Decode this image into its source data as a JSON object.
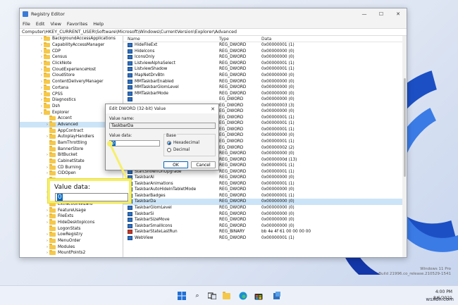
{
  "window": {
    "title": "Registry Editor",
    "minimize": "—",
    "maximize": "☐",
    "close": "✕"
  },
  "menu": [
    "File",
    "Edit",
    "View",
    "Favorites",
    "Help"
  ],
  "address": "Computer\\HKEY_CURRENT_USER\\Software\\Microsoft\\Windows\\CurrentVersion\\Explorer\\Advanced",
  "tree": [
    {
      "label": "BackgroundAccessApplications",
      "indent": 1,
      "chev": "›"
    },
    {
      "label": "CapabilityAccessManager",
      "indent": 1,
      "chev": "›"
    },
    {
      "label": "CDP",
      "indent": 1,
      "chev": "›"
    },
    {
      "label": "Census",
      "indent": 1,
      "chev": "›"
    },
    {
      "label": "ClickNote",
      "indent": 1,
      "chev": "›"
    },
    {
      "label": "CloudExperienceHost",
      "indent": 1,
      "chev": "›"
    },
    {
      "label": "CloudStore",
      "indent": 1,
      "chev": "›"
    },
    {
      "label": "ContentDeliveryManager",
      "indent": 1,
      "chev": "›"
    },
    {
      "label": "Cortana",
      "indent": 1,
      "chev": "›"
    },
    {
      "label": "CPSS",
      "indent": 1,
      "chev": "›"
    },
    {
      "label": "Diagnostics",
      "indent": 1,
      "chev": "›"
    },
    {
      "label": "Dsh",
      "indent": 1,
      "chev": "›"
    },
    {
      "label": "Explorer",
      "indent": 1,
      "chev": "⌄"
    },
    {
      "label": "Accent",
      "indent": 2,
      "chev": ""
    },
    {
      "label": "Advanced",
      "indent": 2,
      "chev": "›",
      "selected": true
    },
    {
      "label": "AppContract",
      "indent": 2,
      "chev": ""
    },
    {
      "label": "AutoplayHandlers",
      "indent": 2,
      "chev": "›"
    },
    {
      "label": "BamThrottling",
      "indent": 2,
      "chev": ""
    },
    {
      "label": "BannerStore",
      "indent": 2,
      "chev": ""
    },
    {
      "label": "BitBucket",
      "indent": 2,
      "chev": "›"
    },
    {
      "label": "CabinetState",
      "indent": 2,
      "chev": ""
    },
    {
      "label": "CD Burning",
      "indent": 2,
      "chev": "›"
    },
    {
      "label": "CIDOpen",
      "indent": 2,
      "chev": "›"
    },
    {
      "label": "",
      "indent": 2,
      "chev": ""
    },
    {
      "label": "",
      "indent": 2,
      "chev": ""
    },
    {
      "label": "Desktop",
      "indent": 2,
      "chev": "›"
    },
    {
      "label": "Discardable",
      "indent": 2,
      "chev": "›"
    },
    {
      "label": "ExtractionWizard",
      "indent": 2,
      "chev": ""
    },
    {
      "label": "FeatureUsage",
      "indent": 2,
      "chev": "›"
    },
    {
      "label": "FileExts",
      "indent": 2,
      "chev": "›"
    },
    {
      "label": "HideDesktopIcons",
      "indent": 2,
      "chev": "›"
    },
    {
      "label": "LogonStats",
      "indent": 2,
      "chev": ""
    },
    {
      "label": "LowRegistry",
      "indent": 2,
      "chev": "›"
    },
    {
      "label": "MenuOrder",
      "indent": 2,
      "chev": "›"
    },
    {
      "label": "Modules",
      "indent": 2,
      "chev": "›"
    },
    {
      "label": "MountPoints2",
      "indent": 2,
      "chev": "›"
    }
  ],
  "columns": {
    "name": "Name",
    "type": "Type",
    "data": "Data"
  },
  "rows": [
    {
      "name": "HideFileExt",
      "type": "REG_DWORD",
      "data": "0x00000001 (1)"
    },
    {
      "name": "HideIcons",
      "type": "REG_DWORD",
      "data": "0x00000000 (0)"
    },
    {
      "name": "IconsOnly",
      "type": "REG_DWORD",
      "data": "0x00000000 (0)"
    },
    {
      "name": "ListviewAlphaSelect",
      "type": "REG_DWORD",
      "data": "0x00000001 (1)"
    },
    {
      "name": "ListviewShadow",
      "type": "REG_DWORD",
      "data": "0x00000001 (1)"
    },
    {
      "name": "MapNetDrvBtn",
      "type": "REG_DWORD",
      "data": "0x00000000 (0)"
    },
    {
      "name": "MMTaskbarEnabled",
      "type": "REG_DWORD",
      "data": "0x00000000 (0)"
    },
    {
      "name": "MMTaskbarGlomLevel",
      "type": "REG_DWORD",
      "data": "0x00000000 (0)"
    },
    {
      "name": "MMTaskbarMode",
      "type": "REG_DWORD",
      "data": "0x00000000 (0)"
    },
    {
      "name": "",
      "type": "EG_DWORD",
      "data": "0x00000000 (0)"
    },
    {
      "name": "",
      "type": "EG_DWORD",
      "data": "0x00000003 (3)"
    },
    {
      "name": "",
      "type": "EG_DWORD",
      "data": "0x00000000 (0)"
    },
    {
      "name": "",
      "type": "EG_DWORD",
      "data": "0x00000001 (1)"
    },
    {
      "name": "",
      "type": "EG_DWORD",
      "data": "0x00000001 (1)"
    },
    {
      "name": "",
      "type": "EG_DWORD",
      "data": "0x00000001 (1)"
    },
    {
      "name": "",
      "type": "EG_DWORD",
      "data": "0x00000000 (0)"
    },
    {
      "name": "",
      "type": "EG_DWORD",
      "data": "0x00000001 (1)"
    },
    {
      "name": "",
      "type": "EG_DWORD",
      "data": "0x00000002 (2)"
    },
    {
      "name": "Start_ShowClassicMode",
      "type": "REG_DWORD",
      "data": "0x00000000 (0)"
    },
    {
      "name": "StartMenuInit",
      "type": "REG_DWORD",
      "data": "0x0000000d (13)"
    },
    {
      "name": "StartMigratedBrowserPin",
      "type": "REG_DWORD",
      "data": "0x00000001 (1)"
    },
    {
      "name": "StartShownOnUpgrade",
      "type": "REG_DWORD",
      "data": "0x00000001 (1)"
    },
    {
      "name": "TaskbarAl",
      "type": "REG_DWORD",
      "data": "0x00000000 (0)"
    },
    {
      "name": "TaskbarAnimations",
      "type": "REG_DWORD",
      "data": "0x00000001 (1)"
    },
    {
      "name": "TaskbarAutoHideInTabletMode",
      "type": "REG_DWORD",
      "data": "0x00000000 (0)"
    },
    {
      "name": "TaskbarBadges",
      "type": "REG_DWORD",
      "data": "0x00000001 (1)"
    },
    {
      "name": "TaskbarDa",
      "type": "REG_DWORD",
      "data": "0x00000000 (0)",
      "selected": true
    },
    {
      "name": "TaskbarGlomLevel",
      "type": "REG_DWORD",
      "data": "0x00000000 (0)"
    },
    {
      "name": "TaskbarSi",
      "type": "REG_DWORD",
      "data": "0x00000000 (0)"
    },
    {
      "name": "TaskbarSizeMove",
      "type": "REG_DWORD",
      "data": "0x00000000 (0)"
    },
    {
      "name": "TaskbarSmallIcons",
      "type": "REG_DWORD",
      "data": "0x00000000 (0)"
    },
    {
      "name": "TaskbarStateLastRun",
      "type": "REG_BINARY",
      "data": "bb 4e 4f 61 00 00 00 00"
    },
    {
      "name": "WebView",
      "type": "REG_DWORD",
      "data": "0x00000001 (1)"
    }
  ],
  "dialog": {
    "title": "Edit DWORD (32-bit) Value",
    "close": "✕",
    "value_name_label": "Value name:",
    "value_name": "TaskbarDa",
    "value_data_label": "Value data:",
    "value_data": "0",
    "base_label": "Base",
    "hex_label": "Hexadecimal",
    "dec_label": "Decimal",
    "ok": "OK",
    "cancel": "Cancel"
  },
  "callout": {
    "label": "Value data:",
    "value": "0",
    "color": "#f6ef6a"
  },
  "taskbar": {
    "time": "4:00 PM",
    "date": "8/6/2021"
  },
  "watermark": {
    "line1": "Windows 11 Pro",
    "line2": "Build 21996.co_release.210529-1541"
  },
  "site": "wsxdn.com"
}
